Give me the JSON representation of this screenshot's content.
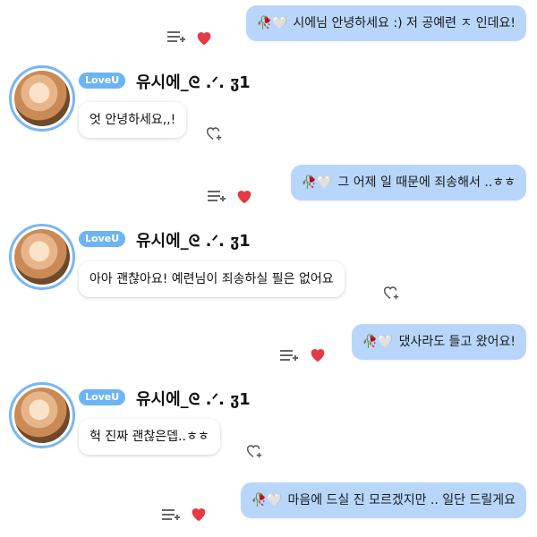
{
  "theme": {
    "accent": "#79b6f5",
    "outgoing_bubble": "#b8d6fb",
    "heart": "#e53945"
  },
  "contact": {
    "badge": "LoveU",
    "name": "유시에_ᘓ .ᐟ. ჳ1"
  },
  "messages": [
    {
      "direction": "out",
      "emoji": "🥀🤍",
      "text": "시에님 안녕하세요 :) 저 공예련 ㅈ 인데요!"
    },
    {
      "direction": "in",
      "text": "엇 안녕하세요,,!"
    },
    {
      "direction": "out",
      "emoji": "🥀🤍",
      "text": "그 어제 일 때문에 죄송해서 ..ㅎㅎ"
    },
    {
      "direction": "in",
      "text": "아아 괜찮아요! 예련님이 죄송하실 필은 없어요"
    },
    {
      "direction": "out",
      "emoji": "🥀🤍",
      "text": "댔사라도 들고 왔어요!"
    },
    {
      "direction": "in",
      "text": "헉 진짜 괜찮은뎁..ㅎㅎ"
    },
    {
      "direction": "out",
      "emoji": "🥀🤍",
      "text": "마음에 드실 진 모르겠지만 .. 일단 드릴게요"
    }
  ]
}
